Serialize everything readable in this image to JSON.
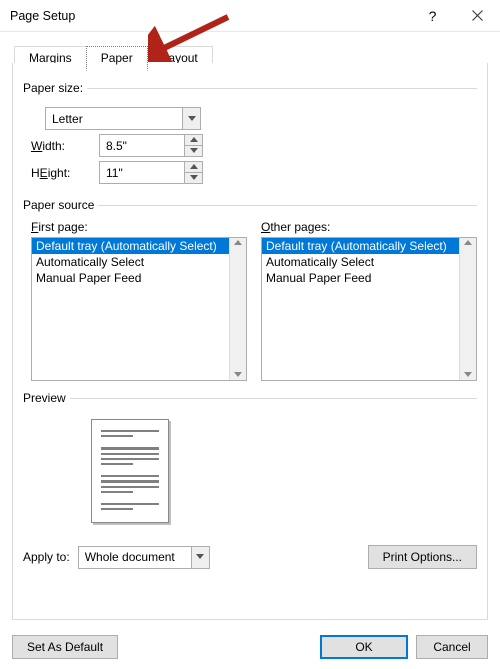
{
  "window": {
    "title": "Page Setup"
  },
  "tabs": {
    "margins": "Margins",
    "paper": "Paper",
    "layout": "Layout"
  },
  "paper_size": {
    "legend": "Paper size:",
    "selected": "Letter",
    "width_label": "Width:",
    "width_value": "8.5\"",
    "height_label": "Height:",
    "height_value": "11\"",
    "width_u": "W",
    "height_u": "E"
  },
  "paper_source": {
    "legend": "Paper source",
    "first_label": "First page:",
    "first_u": "F",
    "other_label": "Other pages:",
    "other_u": "O",
    "items": [
      "Default tray (Automatically Select)",
      "Automatically Select",
      "Manual Paper Feed"
    ]
  },
  "preview": {
    "legend": "Preview"
  },
  "apply_to": {
    "label": "Apply to:",
    "value": "Whole document"
  },
  "buttons": {
    "print_options": "Print Options...",
    "set_default": "Set As Default",
    "ok": "OK",
    "cancel": "Cancel"
  }
}
